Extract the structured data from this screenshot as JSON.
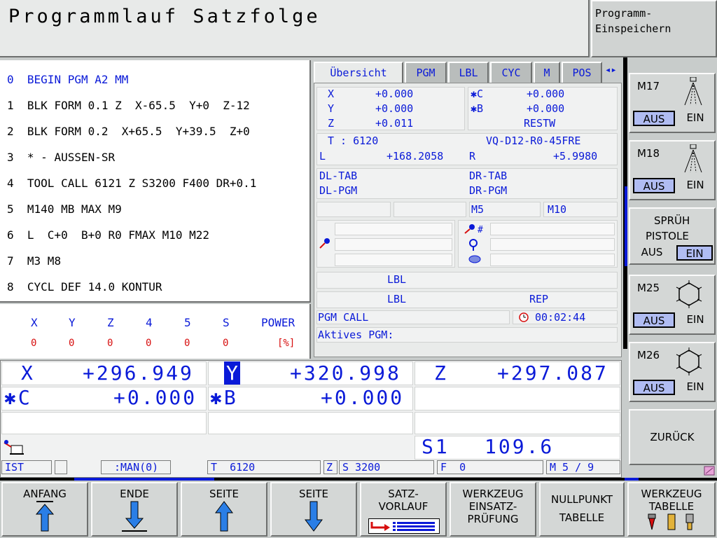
{
  "header": {
    "title": "Programmlauf Satzfolge",
    "mode_button": [
      "Programm-",
      "Einspeichern"
    ]
  },
  "program_lines": [
    {
      "n": "0",
      "text": "BEGIN PGM A2 MM"
    },
    {
      "n": "1",
      "text": "BLK FORM 0.1 Z  X-65.5  Y+0  Z-12"
    },
    {
      "n": "2",
      "text": "BLK FORM 0.2  X+65.5  Y+39.5  Z+0"
    },
    {
      "n": "3",
      "text": "* - AUSSEN-SR"
    },
    {
      "n": "4",
      "text": "TOOL CALL 6121 Z S3200 F400 DR+0.1"
    },
    {
      "n": "5",
      "text": "M140 MB MAX M9"
    },
    {
      "n": "6",
      "text": "L  C+0  B+0 R0 FMAX M10 M22"
    },
    {
      "n": "7",
      "text": "M3 M8"
    },
    {
      "n": "8",
      "text": "CYCL DEF 14.0 KONTUR"
    }
  ],
  "load": {
    "headers": [
      "X",
      "Y",
      "Z",
      "4",
      "5",
      "S",
      "POWER"
    ],
    "values": [
      "0",
      "0",
      "0",
      "0",
      "0",
      "0",
      "[%]"
    ]
  },
  "tabs": [
    "Übersicht",
    "PGM",
    "LBL",
    "CYC",
    "M",
    "POS"
  ],
  "tab_arrows": "◂▸",
  "status": {
    "x_label": "X",
    "x_val": "+0.000",
    "y_label": "Y",
    "y_val": "+0.000",
    "z_label": "Z",
    "z_val": "+0.011",
    "c_label": "✱C",
    "c_val": "+0.000",
    "b_label": "✱B",
    "b_val": "+0.000",
    "restw": "RESTW",
    "t_label": "T : 6120",
    "tool_name": "VQ-D12-R0-45FRE",
    "l_label": "L",
    "l_val": "+168.2058",
    "r_label": "R",
    "r_val": "+5.9980",
    "dl_tab": "DL-TAB",
    "dr_tab": "DR-TAB",
    "dl_pgm": "DL-PGM",
    "dr_pgm": "DR-PGM",
    "m5": "M5",
    "m10": "M10",
    "lbl1": "LBL",
    "lbl2": "LBL",
    "rep": "REP",
    "pgm_call": "PGM CALL",
    "time": "00:02:44",
    "active_pgm": "Aktives PGM:"
  },
  "positions": {
    "x_label": "X",
    "x_val": "+296.949",
    "y_label": "Y",
    "y_val": "+320.998",
    "z_label": "Z",
    "z_val": "+297.087",
    "c_label": "✱C",
    "c_val": "+0.000",
    "b_label": "✱B",
    "b_val": "+0.000",
    "s_label": "S1",
    "s_val": "109.6"
  },
  "status_bar": {
    "ist": "IST",
    "man": ":MAN(0)",
    "tool": "T  6120",
    "axis": "Z",
    "spindle": "S 3200",
    "feed": "F  0",
    "m": "M 5 / 9"
  },
  "vertical_softkeys": [
    {
      "label": "M17",
      "off": "AUS",
      "on": "EIN"
    },
    {
      "label": "M18",
      "off": "AUS",
      "on": "EIN"
    },
    {
      "label": [
        "SPRÜH",
        "PISTOLE"
      ],
      "off": "AUS",
      "on": "EIN"
    },
    {
      "label": "M25",
      "off": "AUS",
      "on": "EIN"
    },
    {
      "label": "M26",
      "off": "AUS",
      "on": "EIN"
    },
    {
      "label": "ZURÜCK"
    }
  ],
  "softkeys": [
    {
      "label": "ANFANG"
    },
    {
      "label": "ENDE"
    },
    {
      "label": "SEITE"
    },
    {
      "label": "SEITE"
    },
    {
      "label": [
        "SATZ-",
        "VORLAUF"
      ]
    },
    {
      "label": [
        "WERKZEUG",
        "EINSATZ-",
        "PRÜFUNG"
      ]
    },
    {
      "label": [
        "NULLPUNKT",
        "TABELLE"
      ]
    },
    {
      "label": [
        "WERKZEUG",
        "TABELLE"
      ]
    }
  ],
  "colors": {
    "accent_blue": "#0a1ad8",
    "highlight": "#b0bcf2",
    "red": "#d70f0f"
  }
}
